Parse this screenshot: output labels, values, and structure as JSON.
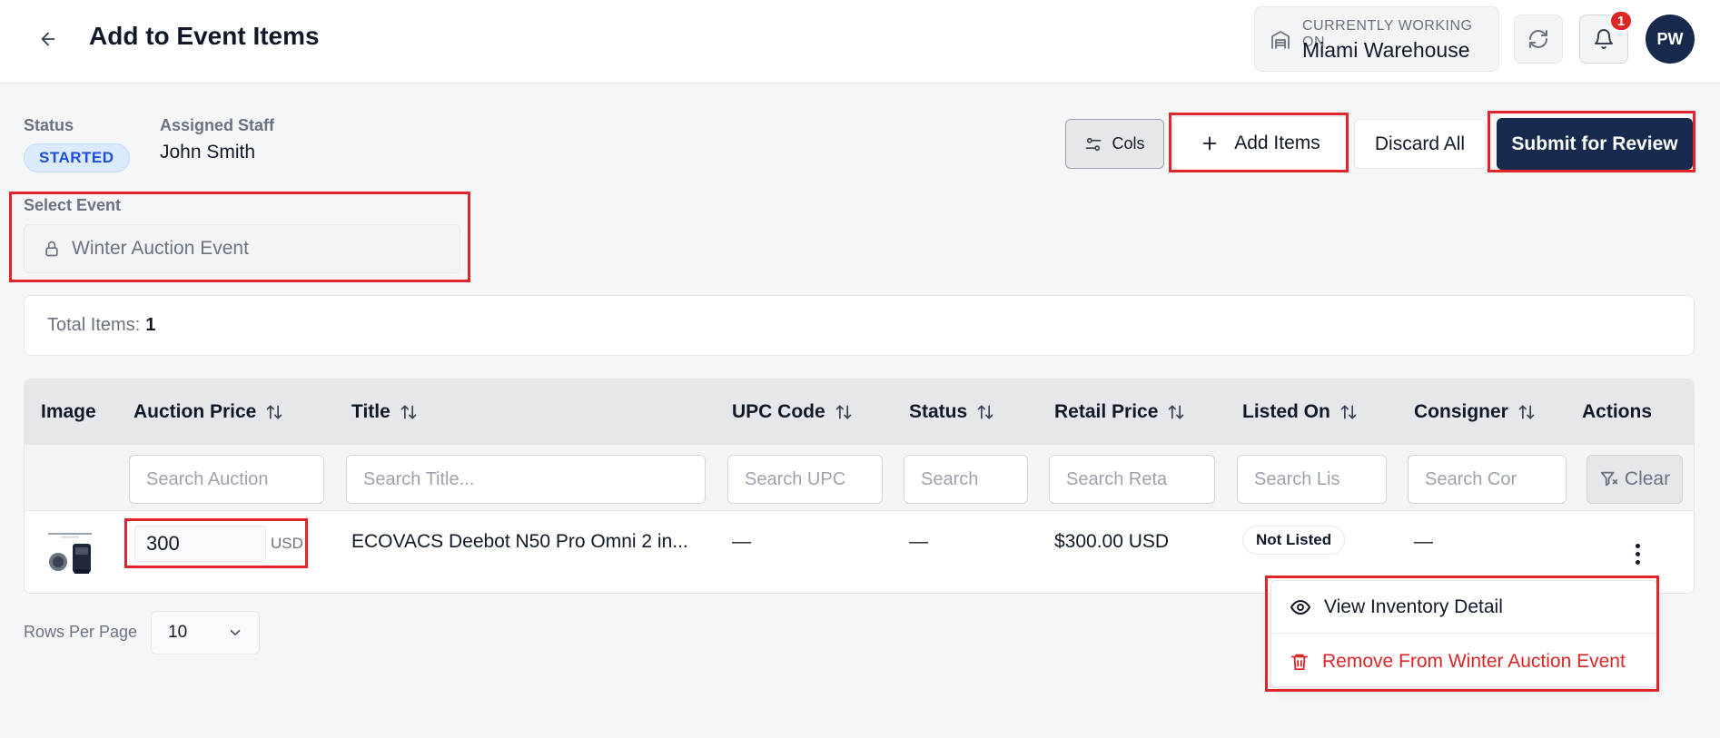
{
  "header": {
    "title": "Add to Event Items",
    "workspace_label": "CURRENTLY WORKING ON",
    "workspace_value": "Miami Warehouse",
    "notification_count": "1",
    "avatar_initials": "PW"
  },
  "info": {
    "status_label": "Status",
    "status_value": "STARTED",
    "staff_label": "Assigned Staff",
    "staff_value": "John Smith"
  },
  "toolbar": {
    "cols_label": "Cols",
    "add_label": "Add Items",
    "discard_label": "Discard All",
    "submit_label": "Submit for Review"
  },
  "event": {
    "label": "Select Event",
    "value": "Winter Auction Event"
  },
  "summary": {
    "total_label": "Total Items:",
    "total_value": "1"
  },
  "table": {
    "columns": [
      {
        "label": "Image",
        "sortable": false
      },
      {
        "label": "Auction Price",
        "sortable": true
      },
      {
        "label": "Title",
        "sortable": true
      },
      {
        "label": "UPC Code",
        "sortable": true
      },
      {
        "label": "Status",
        "sortable": true
      },
      {
        "label": "Retail Price",
        "sortable": true
      },
      {
        "label": "Listed On",
        "sortable": true
      },
      {
        "label": "Consigner",
        "sortable": true
      },
      {
        "label": "Actions",
        "sortable": false
      }
    ],
    "filters": {
      "auction_price": "Search Auction",
      "title": "Search Title...",
      "upc": "Search UPC",
      "status": "Search",
      "retail": "Search Reta",
      "listed_on": "Search Lis",
      "consigner": "Search Cor",
      "clear_label": "Clear"
    },
    "rows": [
      {
        "auction_price": "300",
        "currency": "USD",
        "title": "ECOVACS Deebot N50 Pro Omni 2 in...",
        "upc": "—",
        "status": "—",
        "retail_price": "$300.00 USD",
        "listed_on": "Not Listed",
        "consigner": "—"
      }
    ]
  },
  "pagination": {
    "rows_label": "Rows Per Page",
    "rows_value": "10"
  },
  "row_menu": {
    "view_label": "View Inventory Detail",
    "remove_label": "Remove From Winter Auction Event"
  },
  "colors": {
    "primary": "#172a4d",
    "danger": "#dc2626",
    "highlight": "#e0252b"
  }
}
